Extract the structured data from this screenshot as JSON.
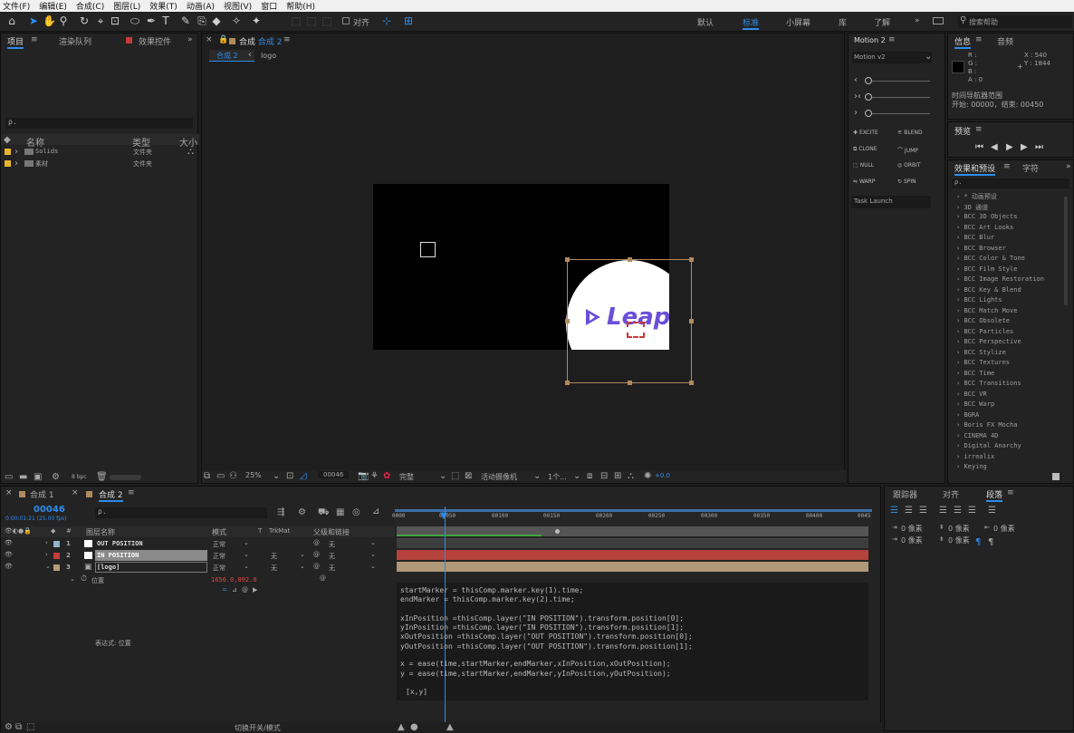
{
  "menu": [
    "文件(F)",
    "编辑(E)",
    "合成(C)",
    "图层(L)",
    "效果(T)",
    "动画(A)",
    "视图(V)",
    "窗口",
    "帮助(H)"
  ],
  "toolbar": {
    "snap_label": "对齐",
    "workspaces": [
      "默认",
      "标准",
      "小屏幕",
      "库",
      "了解"
    ],
    "search_placeholder": "搜索帮助"
  },
  "project": {
    "tabs": [
      "项目",
      "渲染队列",
      "效果控件"
    ],
    "search_placeholder": "ρ.",
    "col_name": "名称",
    "col_type": "类型",
    "col_size": "大小",
    "items": [
      {
        "name": "Solids",
        "type": "文件夹"
      },
      {
        "name": "素材",
        "type": "文件夹"
      }
    ],
    "bpc": "8 bpc"
  },
  "comp": {
    "tab": "合成 2",
    "breadcrumb": [
      "合成 2",
      "logo"
    ],
    "zoom": "25%",
    "timecode": "00046",
    "quality": "完整",
    "camera": "活动摄像机",
    "views": "1个...",
    "exposure": "+0.0",
    "logo_text": "Leap"
  },
  "motion": {
    "title": "Motion 2",
    "version": "Motion v2",
    "buttons": [
      "EXCITE",
      "BLEND",
      "CLONE",
      "JUMP",
      "NULL",
      "ORBIT",
      "WARP",
      "SPIN"
    ],
    "task": "Task Launch"
  },
  "info": {
    "tabs": [
      "信息",
      "音频"
    ],
    "r": "R :",
    "g": "G :",
    "b": "B :",
    "a": "A : 0",
    "x": "X : 540",
    "y": "Y : 1844",
    "nav_title": "时间导航器范围",
    "nav_range": "开始: 00000，结束: 00450"
  },
  "preview": {
    "title": "预览"
  },
  "effects": {
    "tabs": [
      "效果和预设",
      "字符"
    ],
    "search_placeholder": "ρ.",
    "items": [
      "* 动画预设",
      "3D 通道",
      "BCC 3D Objects",
      "BCC Art Looks",
      "BCC Blur",
      "BCC Browser",
      "BCC Color & Tone",
      "BCC Film Style",
      "BCC Image Restoration",
      "BCC Key & Blend",
      "BCC Lights",
      "BCC Match Move",
      "BCC Obsolete",
      "BCC Particles",
      "BCC Perspective",
      "BCC Stylize",
      "BCC Textures",
      "BCC Time",
      "BCC Transitions",
      "BCC VR",
      "BCC Warp",
      "BGRA",
      "Boris FX Mocha",
      "CINEMA 4D",
      "Digital Anarchy",
      "irrealix",
      "Keying"
    ]
  },
  "paragraph": {
    "tabs": [
      "跟踪器",
      "对齐",
      "段落"
    ],
    "px_label": "0 像素"
  },
  "timeline": {
    "tabs": [
      "合成 1",
      "合成 2"
    ],
    "timecode": "00046",
    "subtime": "0:00:01:21 (25.00 fps)",
    "search_placeholder": "ρ.",
    "col_name": "图层名称",
    "col_mode": "模式",
    "col_t": "T",
    "col_trkmat": "TrkMat",
    "col_parent": "父级和链接",
    "ruler": [
      "0000",
      "00050",
      "00100",
      "00150",
      "00200",
      "00250",
      "00300",
      "00350",
      "00400",
      "0045"
    ],
    "layers": [
      {
        "num": "1",
        "name": "OUT POSITION",
        "mode": "正常",
        "trk": "",
        "parent": "无",
        "color": "#8fb3c7",
        "bar": "#3d3d3d"
      },
      {
        "num": "2",
        "name": "IN POSITION",
        "mode": "正常",
        "trk": "无",
        "parent": "无",
        "color": "#c63a3a",
        "bar": "#b5423c"
      },
      {
        "num": "3",
        "name": "[logo]",
        "mode": "正常",
        "trk": "无",
        "parent": "无",
        "color": "#b59c7a",
        "bar": "#b09778"
      }
    ],
    "prop_name": "位置",
    "prop_value": "1656.0,892.0",
    "expr_label": "表达式: 位置",
    "toggle": "切换开关/模式"
  },
  "expression": [
    "startMarker = thisComp.marker.key(1).time;",
    "endMarker = thisComp.marker.key(2).time;",
    "",
    "xInPosition =thisComp.layer(\"IN POSITION\").transform.position[0];",
    "yInPosition =thisComp.layer(\"IN POSITION\").transform.position[1];",
    "xOutPosition =thisComp.layer(\"OUT POSITION\").transform.position[0];",
    "yOutPosition =thisComp.layer(\"OUT POSITION\").transform.position[1];",
    "",
    "x = ease(time,startMarker,endMarker,xInPosition,xOutPosition);",
    "y = ease(time,startMarker,endMarker,yInPosition,yOutPosition);",
    "",
    "[x,y]"
  ],
  "colors": {
    "accent": "#2d8ceb",
    "logo": "#6a4fd8"
  }
}
